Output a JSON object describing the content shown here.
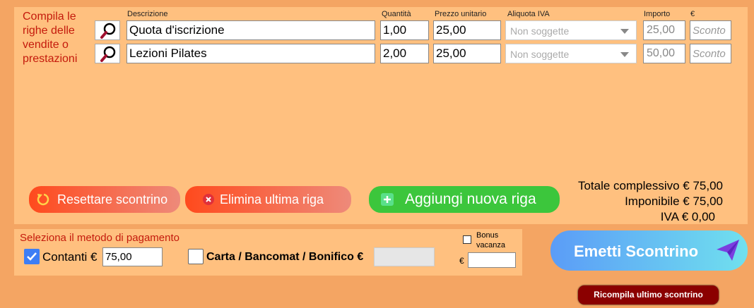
{
  "intro_text": "Compila le righe delle vendite o prestazioni",
  "headers": {
    "descrizione": "Descrizione",
    "quantita": "Quantità",
    "prezzo_unitario": "Prezzo unitario",
    "aliquota_iva": "Aliquota IVA",
    "importo": "Importo",
    "euro": "€"
  },
  "rows": [
    {
      "descrizione": "Quota d'iscrizione",
      "quantita": "1,00",
      "prezzo": "25,00",
      "aliquota": "Non soggette",
      "importo": "25,00",
      "sconto_placeholder": "Sconto"
    },
    {
      "descrizione": "Lezioni Pilates",
      "quantita": "2,00",
      "prezzo": "25,00",
      "aliquota": "Non soggette",
      "importo": "50,00",
      "sconto_placeholder": "Sconto"
    }
  ],
  "buttons": {
    "reset": "Resettare scontrino",
    "elimina": "Elimina ultima riga",
    "aggiungi": "Aggiungi nuova riga",
    "emetti": "Emetti Scontrino",
    "ricompila": "Ricompila ultimo scontrino"
  },
  "totals": {
    "totale": "Totale complessivo € 75,00",
    "imponibile": "Imponibile € 75,00",
    "iva": "IVA € 0,00"
  },
  "payment": {
    "title": "Seleziona il metodo di pagamento",
    "contanti_label": "Contanti €",
    "contanti_value": "75,00",
    "contanti_checked": true,
    "carta_label": "Carta / Bancomat / Bonifico €",
    "carta_value": "",
    "carta_checked": false,
    "bonus_label": "Bonus vacanza",
    "bonus_euro": "€",
    "bonus_value": ""
  },
  "icons": {
    "search": "magnifier-icon",
    "reset": "refresh-icon",
    "delete": "x-circle-icon",
    "add": "plus-square-icon",
    "send": "paper-plane-icon",
    "dropdown": "chevron-down-icon"
  },
  "colors": {
    "background": "#f4a563",
    "panel": "#ffc07f",
    "title_red": "#c41a0c",
    "reset_button": "#ff4a1d",
    "add_button": "#3cc63c",
    "emetti_start": "#5b9cf7",
    "emetti_end": "#70e0ee",
    "ricompila_button": "#8b0000"
  }
}
